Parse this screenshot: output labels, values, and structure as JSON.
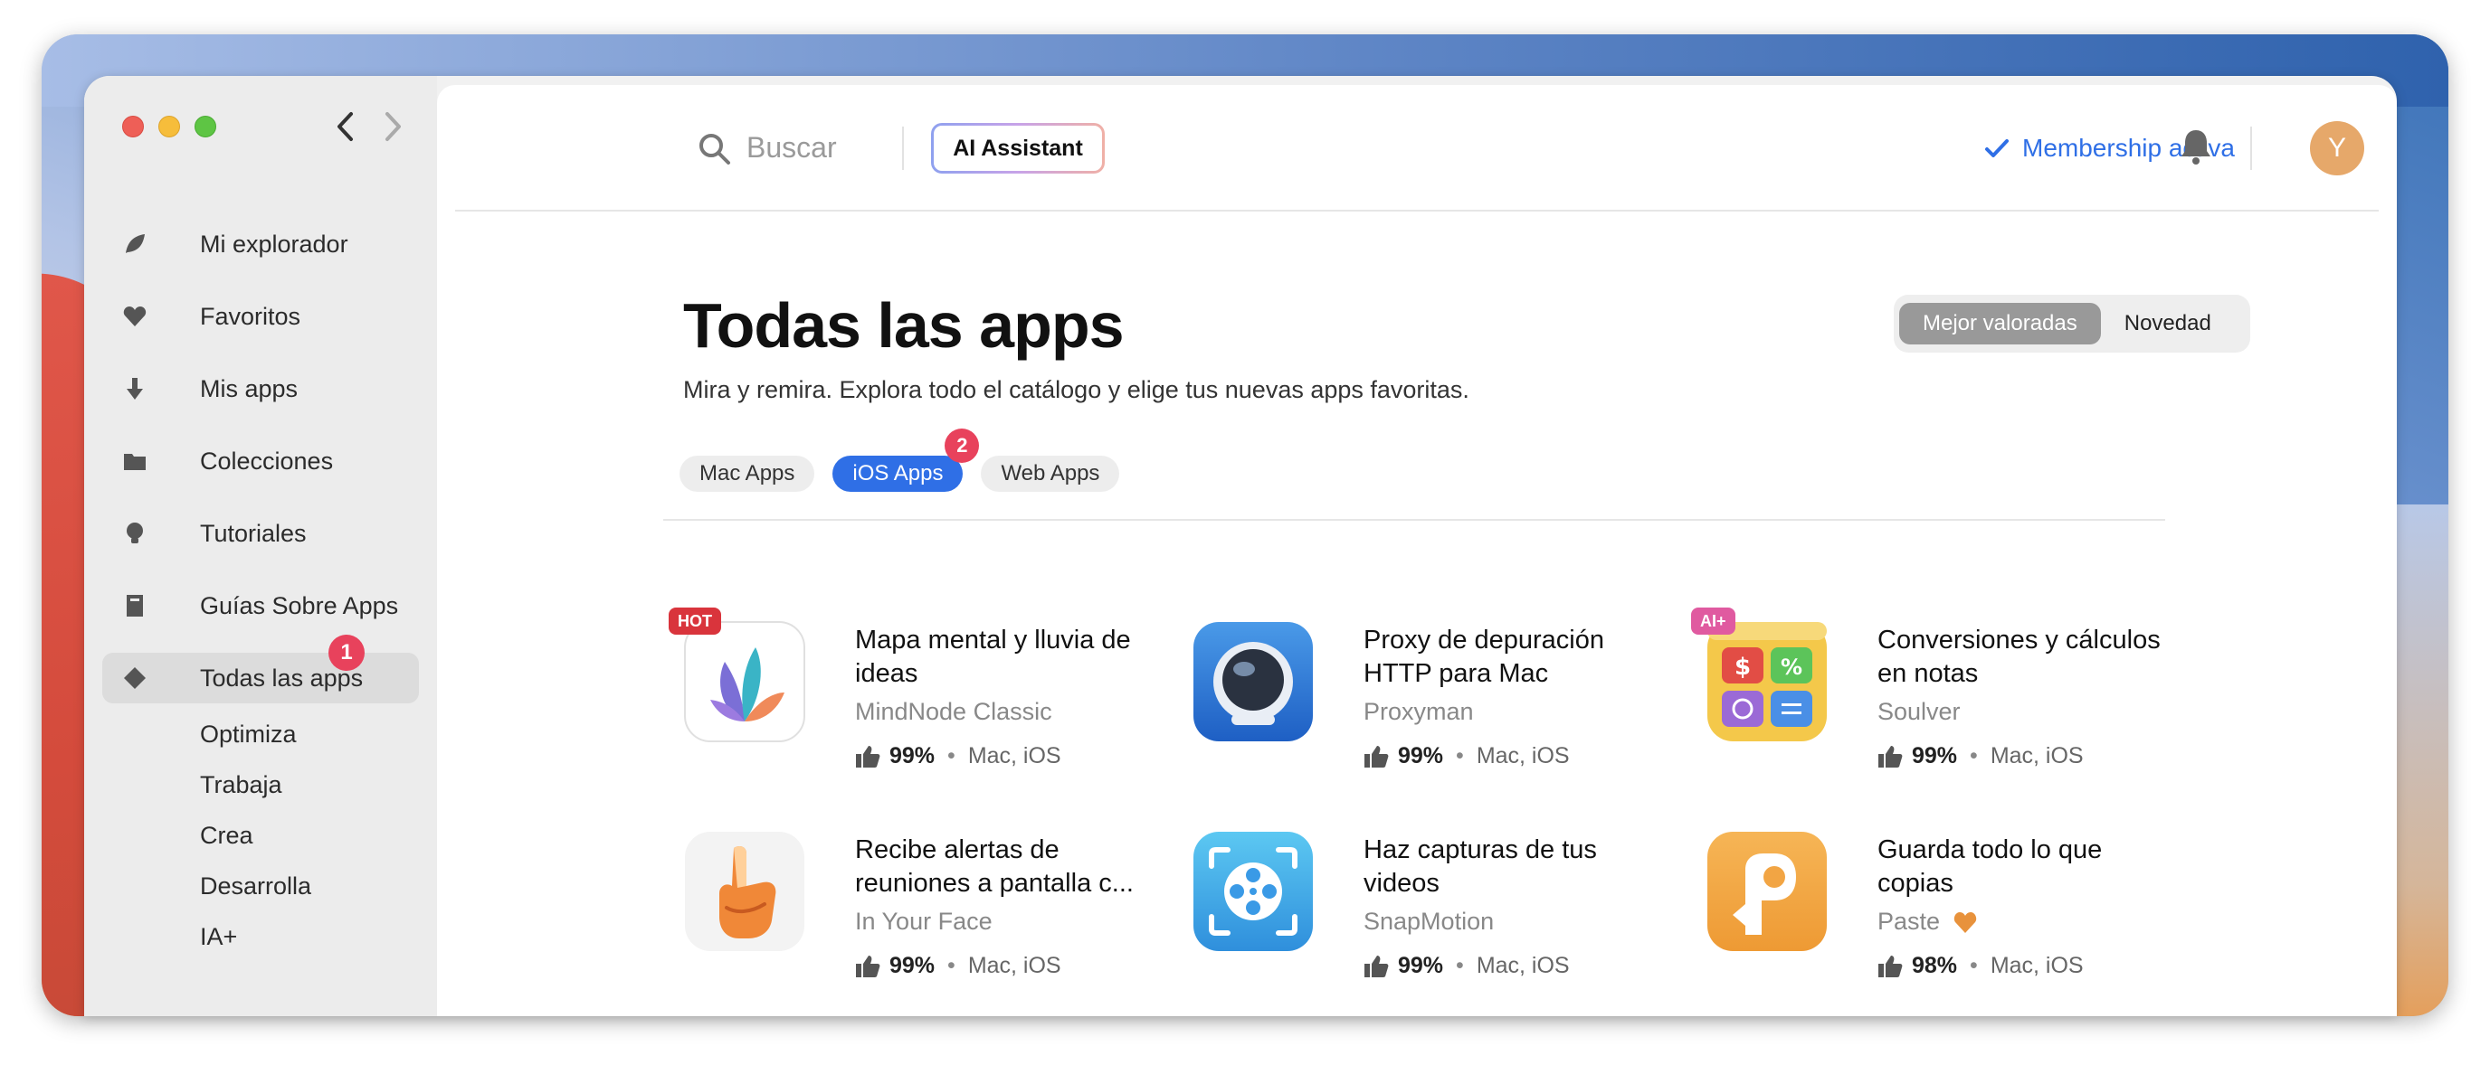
{
  "sidebar": {
    "nav_back_label": "‹",
    "items": [
      {
        "label": "Mi explorador",
        "icon": "leaf-icon"
      },
      {
        "label": "Favoritos",
        "icon": "heart-icon"
      },
      {
        "label": "Mis apps",
        "icon": "download-arrow-icon"
      },
      {
        "label": "Colecciones",
        "icon": "folder-icon"
      },
      {
        "label": "Tutoriales",
        "icon": "lightbulb-icon"
      },
      {
        "label": "Guías Sobre Apps",
        "icon": "book-icon"
      },
      {
        "label": "Todas las apps",
        "icon": "diamond-icon",
        "active": true,
        "badge": "1"
      }
    ],
    "subitems": [
      "Optimiza",
      "Trabaja",
      "Crea",
      "Desarrolla",
      "IA+"
    ]
  },
  "topbar": {
    "search_placeholder": "Buscar",
    "ai_button": "AI Assistant",
    "membership": "Membership activa",
    "avatar_initial": "Y"
  },
  "page": {
    "title": "Todas las apps",
    "subtitle": "Mira y remira. Explora todo el catálogo y elige tus nuevas apps favoritas.",
    "sort": {
      "options": [
        "Mejor valoradas",
        "Novedad"
      ],
      "selected": "Mejor valoradas"
    },
    "filters": [
      {
        "label": "Mac Apps",
        "active": false
      },
      {
        "label": "iOS Apps",
        "active": true,
        "badge": "2"
      },
      {
        "label": "Web Apps",
        "active": false
      }
    ]
  },
  "apps": [
    {
      "title": "Mapa mental y lluvia de ideas",
      "developer": "MindNode Classic",
      "rating": "99%",
      "platforms": "Mac, iOS",
      "tag": "HOT",
      "icon": "mindnode-icon"
    },
    {
      "title": "Proxy de depuración HTTP para Mac",
      "developer": "Proxyman",
      "rating": "99%",
      "platforms": "Mac, iOS",
      "icon": "proxyman-astronaut-icon"
    },
    {
      "title": "Conversiones y cálculos en notas",
      "developer": "Soulver",
      "rating": "99%",
      "platforms": "Mac, iOS",
      "tag": "AI+",
      "icon": "soulver-calculator-icon"
    },
    {
      "title": "Recibe alertas de reuniones a pantalla c...",
      "developer": "In Your Face",
      "rating": "99%",
      "platforms": "Mac, iOS",
      "icon": "pointing-hand-icon"
    },
    {
      "title": "Haz capturas de tus videos",
      "developer": "SnapMotion",
      "rating": "99%",
      "platforms": "Mac, iOS",
      "icon": "film-reel-icon"
    },
    {
      "title": "Guarda todo lo que copias",
      "developer": "Paste",
      "rating": "98%",
      "platforms": "Mac, iOS",
      "icon": "paste-icon",
      "developer_badge": "heart"
    }
  ],
  "colors": {
    "accent": "#2f6fe6",
    "badge": "#e8425c",
    "hot_tag": "#d9343c",
    "ai_tag": "#e05aa0",
    "heart": "#e8923c"
  }
}
